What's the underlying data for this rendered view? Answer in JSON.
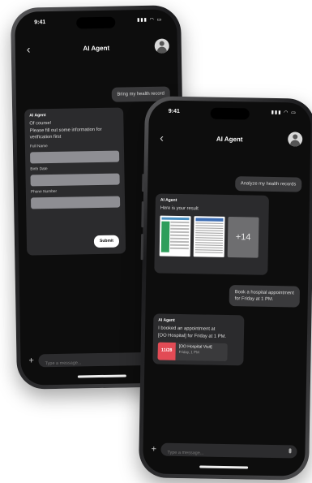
{
  "back_phone": {
    "status": {
      "time": "9:41"
    },
    "header": {
      "title": "AI Agent"
    },
    "messages": {
      "user_1": "Bring my health record",
      "agent_1": {
        "sender": "AI Agent",
        "lines": [
          "Of course!",
          "Please fill out some information for",
          "verification first"
        ],
        "fields": [
          "Full Name",
          "Birth Date",
          "Phone Number"
        ],
        "submit_label": "Submit"
      }
    },
    "composer": {
      "placeholder": "Type a message..."
    }
  },
  "front_phone": {
    "status": {
      "time": "9:41"
    },
    "header": {
      "title": "AI Agent"
    },
    "messages": {
      "user_1": "Analyze my health records",
      "agent_1": {
        "sender": "AI Agent",
        "text": "Here is your result",
        "more_count": "+14"
      },
      "user_2": {
        "line1": "Book a hospital appointment",
        "line2": "for Friday at 1 PM."
      },
      "agent_2": {
        "sender": "AI Agent",
        "line1": "I booked an appointment at",
        "line2": "[OO Hospital] for Friday at 1 PM.",
        "card": {
          "date": "11/28",
          "title": "[OO Hospital Visit]",
          "subtitle": "Friday, 1 PM"
        }
      }
    },
    "composer": {
      "placeholder": "Type a message..."
    }
  },
  "colors": {
    "screen": "#0d0d0d",
    "bubble_user": "#3a3a3c",
    "bubble_agent": "#2b2b2d",
    "accent_red": "#e24b55"
  }
}
